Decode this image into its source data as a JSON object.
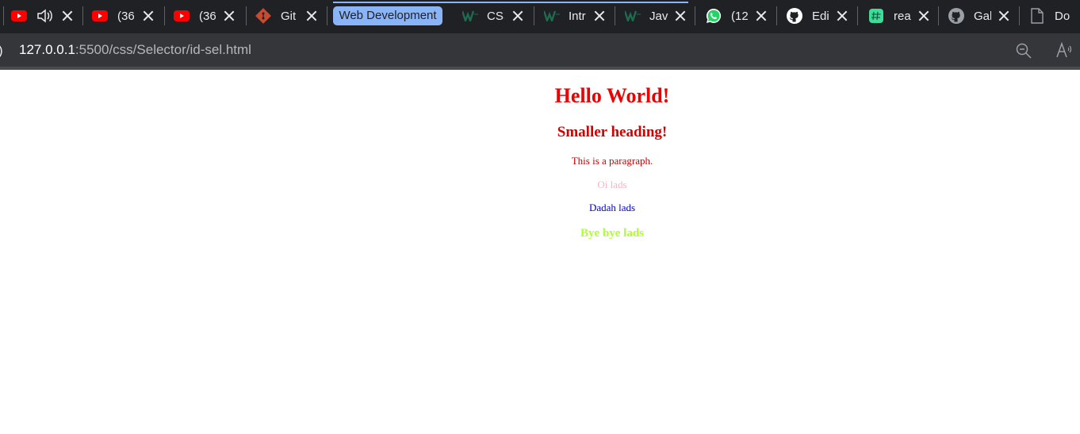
{
  "tabs": [
    {
      "title": "",
      "icon": "youtube-icon",
      "audio": true
    },
    {
      "title": "(36",
      "icon": "youtube-icon"
    },
    {
      "title": "(36",
      "icon": "youtube-icon"
    },
    {
      "title": "Git",
      "icon": "git-icon"
    },
    {
      "title": "CSS",
      "icon": "w3schools-icon"
    },
    {
      "title": "Intr",
      "icon": "w3schools-icon"
    },
    {
      "title": "Java",
      "icon": "w3schools-icon"
    },
    {
      "title": "(12",
      "icon": "whatsapp-icon"
    },
    {
      "title": "Edi",
      "icon": "github-icon"
    },
    {
      "title": "rea",
      "icon": "hashtag-icon"
    },
    {
      "title": "Gal",
      "icon": "github-icon"
    },
    {
      "title": "Do",
      "icon": "document-icon"
    }
  ],
  "tab_group": {
    "label": "Web Development",
    "color": "#8ab4f8"
  },
  "address_bar": {
    "host": "127.0.0.1",
    "path": ":5500/css/Selector/id-sel.html"
  },
  "page": {
    "heading": "Hello World!",
    "subheading": "Smaller heading!",
    "paragraph": "This is a paragraph.",
    "line_oi": "Oi lads",
    "line_dadah": "Dadah lads",
    "line_bye": "Bye bye lads"
  },
  "colors": {
    "heading": "#ee0000",
    "subheading": "#d40000",
    "paragraph": "#cc0000",
    "oi": "#f4b6c2",
    "dadah": "#0000cc",
    "bye": "#adff2f"
  }
}
